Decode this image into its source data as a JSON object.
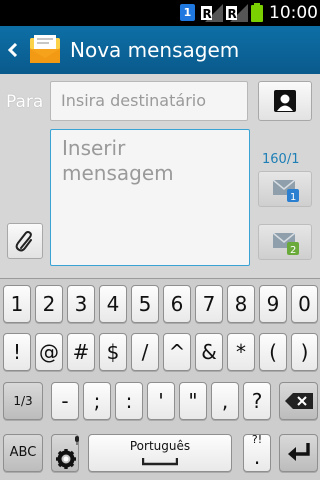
{
  "status_bar": {
    "sim_badge": "1",
    "signal_labels": [
      "R",
      "R"
    ],
    "time": "10:00",
    "colors": {
      "sim": "#1e78e0",
      "battery": "#7ad000"
    }
  },
  "title_bar": {
    "title": "Nova mensagem",
    "back_icon": "chevron-left-icon",
    "app_icon": "envelope-icon"
  },
  "compose": {
    "to_label": "Para",
    "to_placeholder": "Insira destinatário",
    "message_placeholder": "Inserir\nmensagem",
    "counter": "160/1",
    "send_sim1_badge": "1",
    "send_sim2_badge": "2"
  },
  "keyboard": {
    "row_numbers": [
      "1",
      "2",
      "3",
      "4",
      "5",
      "6",
      "7",
      "8",
      "9",
      "0"
    ],
    "row_symbols": [
      "!",
      "@",
      "#",
      "$",
      "/",
      "^",
      "&",
      "*",
      "(",
      ")"
    ],
    "row_punct": [
      "-",
      ";",
      ":",
      "'",
      "\"",
      "?"
    ],
    "page_key": "1/3",
    "comma_key": ",",
    "abc_key": "ABC",
    "space_label": "Português",
    "period_key": ".",
    "period_alt": "?!",
    "backspace_icon": "backspace-icon",
    "enter_icon": "enter-icon",
    "settings_icon": "gear-icon",
    "mic_icon": "mic-icon"
  }
}
